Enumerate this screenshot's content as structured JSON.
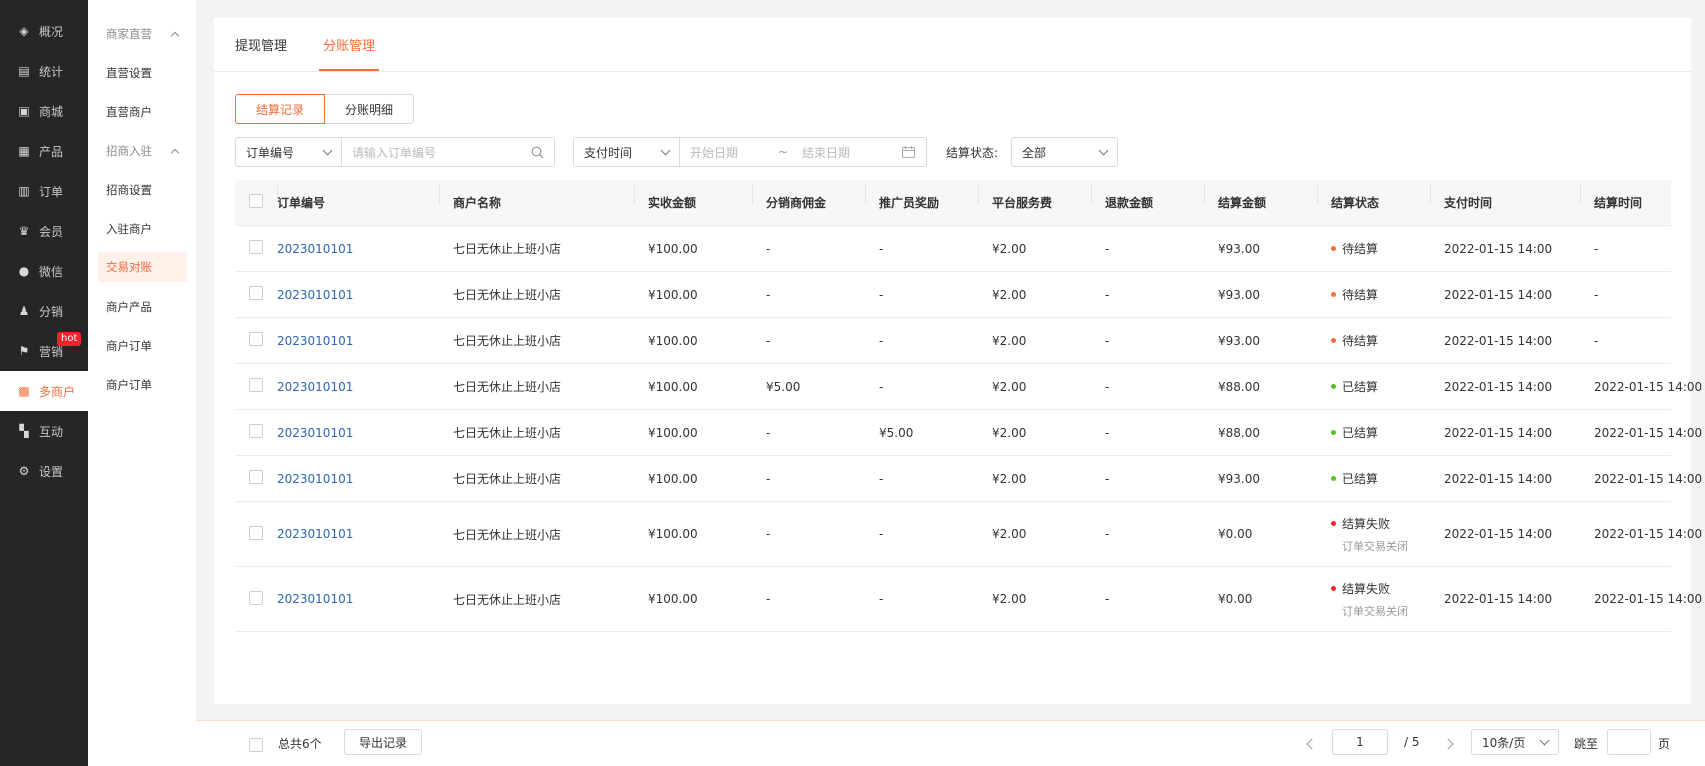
{
  "nav": [
    {
      "label": "概况",
      "icon": "layers-icon",
      "glyph": "◈"
    },
    {
      "label": "统计",
      "icon": "chart-icon",
      "glyph": "▤"
    },
    {
      "label": "商城",
      "icon": "shop-icon",
      "glyph": "▣"
    },
    {
      "label": "产品",
      "icon": "grid-icon",
      "glyph": "▦"
    },
    {
      "label": "订单",
      "icon": "order-icon",
      "glyph": "▥"
    },
    {
      "label": "会员",
      "icon": "crown-icon",
      "glyph": "♛"
    },
    {
      "label": "微信",
      "icon": "wechat-icon",
      "glyph": "●"
    },
    {
      "label": "分销",
      "icon": "user-icon",
      "glyph": "♟"
    },
    {
      "label": "营销",
      "icon": "flag-icon",
      "glyph": "⚑",
      "badge": "hot"
    },
    {
      "label": "多商户",
      "icon": "merchant-icon",
      "glyph": "▩"
    },
    {
      "label": "互动",
      "icon": "interact-icon",
      "glyph": "▚"
    },
    {
      "label": "设置",
      "icon": "gear-icon",
      "glyph": "⚙"
    }
  ],
  "subnav": {
    "group1": "商家直营",
    "g1_items": [
      "直营设置",
      "直营商户"
    ],
    "group2": "招商入驻",
    "g2_items": [
      "招商设置",
      "入驻商户",
      "交易对账",
      "商户产品",
      "商户订单",
      "商户订单"
    ]
  },
  "tabs": [
    "提现管理",
    "分账管理"
  ],
  "segments": [
    "结算记录",
    "分账明细"
  ],
  "filters": {
    "order_select": "订单编号",
    "order_placeholder": "请输入订单编号",
    "time_select": "支付时间",
    "start_placeholder": "开始日期",
    "range_sep": "~",
    "end_placeholder": "结束日期",
    "status_label": "结算状态:",
    "status_value": "全部"
  },
  "columns": [
    "订单编号",
    "商户名称",
    "实收金额",
    "分销商佣金",
    "推广员奖励",
    "平台服务费",
    "退款金额",
    "结算金额",
    "结算状态",
    "支付时间",
    "结算时间"
  ],
  "rows": [
    {
      "order": "2023010101",
      "merchant": "七日无休止上班小店",
      "received": "¥100.00",
      "commission": "-",
      "reward": "-",
      "fee": "¥2.00",
      "refund": "-",
      "settle": "¥93.00",
      "status": "待结算",
      "status_color": "#f36c3a",
      "note": "",
      "pay_time": "2022-01-15  14:00",
      "settle_time": "-"
    },
    {
      "order": "2023010101",
      "merchant": "七日无休止上班小店",
      "received": "¥100.00",
      "commission": "-",
      "reward": "-",
      "fee": "¥2.00",
      "refund": "-",
      "settle": "¥93.00",
      "status": "待结算",
      "status_color": "#f36c3a",
      "note": "",
      "pay_time": "2022-01-15  14:00",
      "settle_time": "-"
    },
    {
      "order": "2023010101",
      "merchant": "七日无休止上班小店",
      "received": "¥100.00",
      "commission": "-",
      "reward": "-",
      "fee": "¥2.00",
      "refund": "-",
      "settle": "¥93.00",
      "status": "待结算",
      "status_color": "#f36c3a",
      "note": "",
      "pay_time": "2022-01-15  14:00",
      "settle_time": "-"
    },
    {
      "order": "2023010101",
      "merchant": "七日无休止上班小店",
      "received": "¥100.00",
      "commission": "¥5.00",
      "reward": "-",
      "fee": "¥2.00",
      "refund": "-",
      "settle": "¥88.00",
      "status": "已结算",
      "status_color": "#52c41a",
      "note": "",
      "pay_time": "2022-01-15  14:00",
      "settle_time": "2022-01-15  14:00"
    },
    {
      "order": "2023010101",
      "merchant": "七日无休止上班小店",
      "received": "¥100.00",
      "commission": "-",
      "reward": "¥5.00",
      "fee": "¥2.00",
      "refund": "-",
      "settle": "¥88.00",
      "status": "已结算",
      "status_color": "#52c41a",
      "note": "",
      "pay_time": "2022-01-15  14:00",
      "settle_time": "2022-01-15  14:00"
    },
    {
      "order": "2023010101",
      "merchant": "七日无休止上班小店",
      "received": "¥100.00",
      "commission": "-",
      "reward": "-",
      "fee": "¥2.00",
      "refund": "-",
      "settle": "¥93.00",
      "status": "已结算",
      "status_color": "#52c41a",
      "note": "",
      "pay_time": "2022-01-15  14:00",
      "settle_time": "2022-01-15  14:00"
    },
    {
      "order": "2023010101",
      "merchant": "七日无休止上班小店",
      "received": "¥100.00",
      "commission": "-",
      "reward": "-",
      "fee": "¥2.00",
      "refund": "-",
      "settle": "¥0.00",
      "status": "结算失败",
      "status_color": "#f5222d",
      "note": "订单交易关闭",
      "pay_time": "2022-01-15  14:00",
      "settle_time": "2022-01-15  14:00"
    },
    {
      "order": "2023010101",
      "merchant": "七日无休止上班小店",
      "received": "¥100.00",
      "commission": "-",
      "reward": "-",
      "fee": "¥2.00",
      "refund": "-",
      "settle": "¥0.00",
      "status": "结算失败",
      "status_color": "#f5222d",
      "note": "订单交易关闭",
      "pay_time": "2022-01-15  14:00",
      "settle_time": "2022-01-15  14:00"
    }
  ],
  "footer": {
    "total": "总共6个",
    "export": "导出记录",
    "page": "1",
    "of_pages": "/  5",
    "page_size": "10条/页",
    "jump": "跳至",
    "page_unit": "页"
  }
}
